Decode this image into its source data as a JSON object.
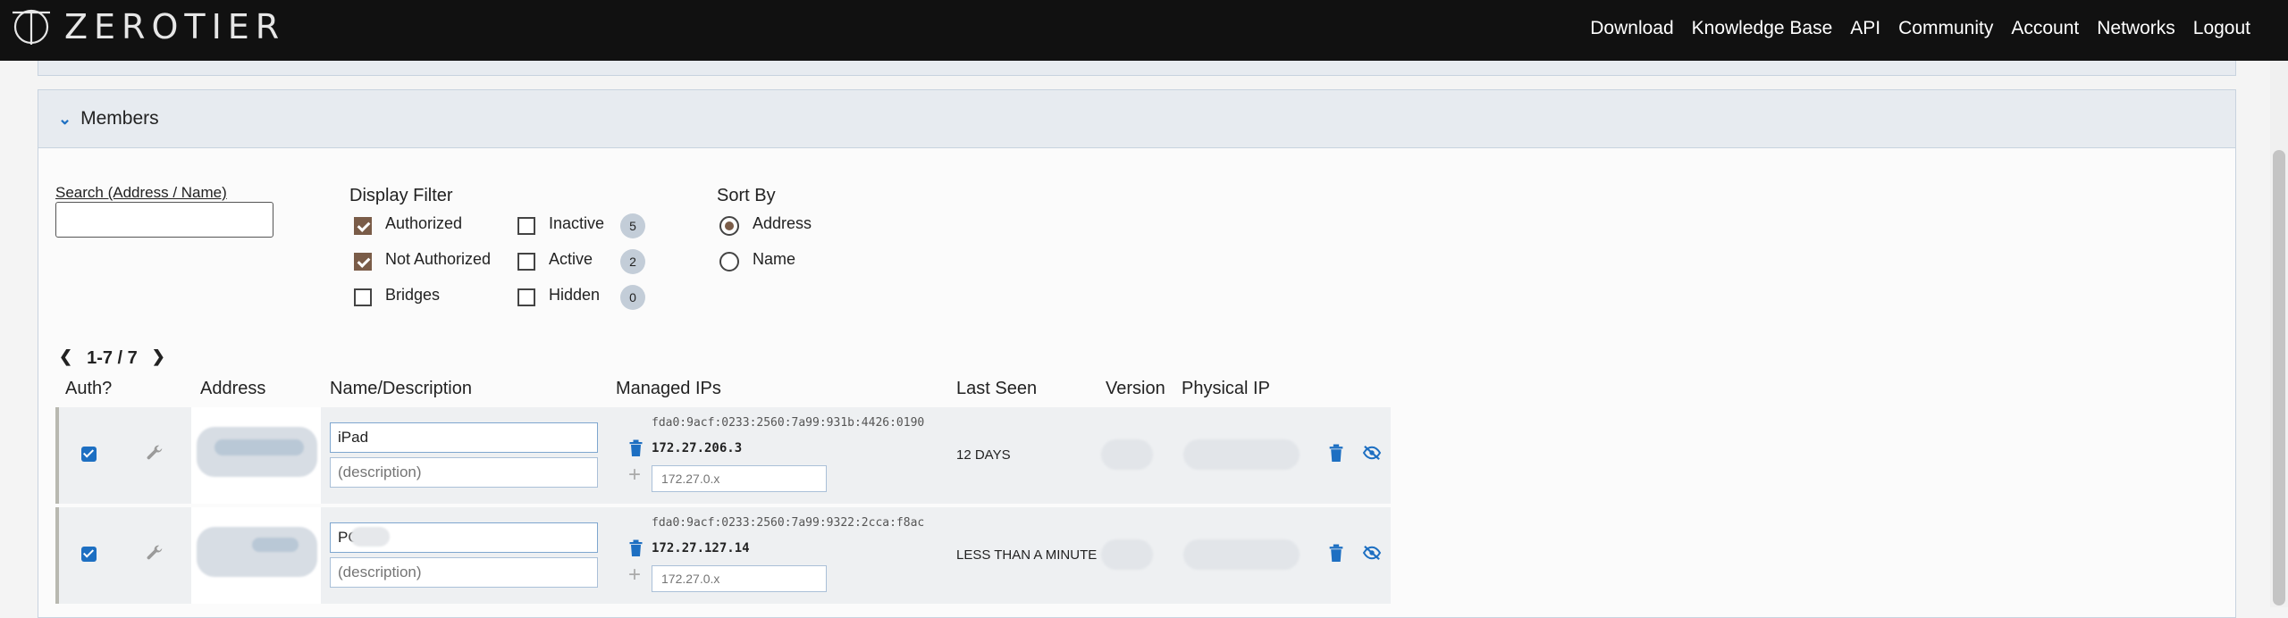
{
  "brand": {
    "name": "ZEROTIER"
  },
  "nav": [
    "Download",
    "Knowledge Base",
    "API",
    "Community",
    "Account",
    "Networks",
    "Logout"
  ],
  "members": {
    "title": "Members",
    "search": {
      "label": "Search (Address / Name)",
      "value": ""
    },
    "display_filter": {
      "label": "Display Filter",
      "options": [
        {
          "label": "Authorized",
          "checked": true
        },
        {
          "label": "Not Authorized",
          "checked": true
        },
        {
          "label": "Bridges",
          "checked": false
        },
        {
          "label": "Inactive",
          "checked": false,
          "count": "5"
        },
        {
          "label": "Active",
          "checked": false,
          "count": "2"
        },
        {
          "label": "Hidden",
          "checked": false,
          "count": "0"
        }
      ]
    },
    "sort_by": {
      "label": "Sort By",
      "options": [
        {
          "label": "Address",
          "selected": true
        },
        {
          "label": "Name",
          "selected": false
        }
      ]
    },
    "pagination": "1-7 / 7",
    "columns": [
      "Auth?",
      "Address",
      "Name/Description",
      "Managed IPs",
      "Last Seen",
      "Version",
      "Physical IP"
    ],
    "rows": [
      {
        "authorized": true,
        "name": "iPad",
        "description_placeholder": "(description)",
        "ipv6": "fda0:9acf:0233:2560:7a99:931b:4426:0190",
        "ipv4": "172.27.206.3",
        "ip_placeholder": "172.27.0.x",
        "last_seen": "12 DAYS"
      },
      {
        "authorized": true,
        "name": "PC",
        "description_placeholder": "(description)",
        "ipv6": "fda0:9acf:0233:2560:7a99:9322:2cca:f8ac",
        "ipv4": "172.27.127.14",
        "ip_placeholder": "172.27.0.x",
        "last_seen": "LESS THAN A MINUTE"
      }
    ]
  },
  "colors": {
    "accent": "#1d6fc2",
    "checkbox_checked": "#7a5c48",
    "topbar": "#111111"
  }
}
